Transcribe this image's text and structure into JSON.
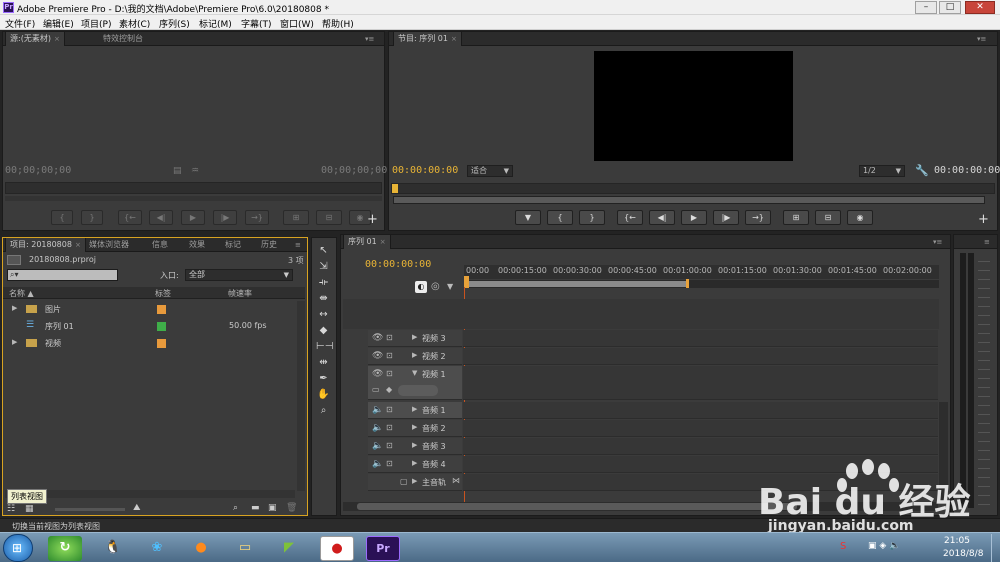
{
  "window": {
    "title": "Adobe Premiere Pro - D:\\我的文档\\Adobe\\Premiere Pro\\6.0\\20180808 *",
    "app_icon_text": "Pr"
  },
  "menu": [
    "文件(F)",
    "编辑(E)",
    "项目(P)",
    "素材(C)",
    "序列(S)",
    "标记(M)",
    "字幕(T)",
    "窗口(W)",
    "帮助(H)"
  ],
  "source_panel": {
    "tabs": [
      "源:(无素材)",
      "特效控制台"
    ],
    "timecode_left": "00;00;00;00",
    "timecode_right": "00;00;00;00"
  },
  "program_panel": {
    "tab": "节目: 序列 01",
    "timecode_left": "00:00:00:00",
    "fit_label": "适合",
    "resolution": "1/2",
    "timecode_right": "00:00:00:00"
  },
  "project_panel": {
    "tabs": [
      "项目: 20180808",
      "媒体浏览器",
      "信息",
      "效果",
      "标记",
      "历史"
    ],
    "file_name": "20180808.prproj",
    "item_count": "3 项",
    "in_label": "入口:",
    "in_value": "全部",
    "columns": [
      "名称",
      "标签",
      "帧速率"
    ],
    "items": [
      {
        "name": "图片",
        "label_color": "#e89a3c",
        "fps": ""
      },
      {
        "name": "序列 01",
        "label_color": "#3fae49",
        "fps": "50.00 fps"
      },
      {
        "name": "视频",
        "label_color": "#e89a3c",
        "fps": ""
      }
    ],
    "tooltip": "列表视图"
  },
  "timeline": {
    "tab": "序列 01",
    "timecode": "00:00:00:00",
    "ruler": [
      "00:00",
      "00:00:15:00",
      "00:00:30:00",
      "00:00:45:00",
      "00:01:00:00",
      "00:01:15:00",
      "00:01:30:00",
      "00:01:45:00",
      "00:02:00:00"
    ],
    "video_tracks": [
      "视频 3",
      "视频 2",
      "视频 1"
    ],
    "audio_tracks": [
      "音频 1",
      "音频 2",
      "音频 3",
      "音频 4"
    ],
    "master_track": "主音轨"
  },
  "status_bar": "切换当前视图为列表视图",
  "watermark": {
    "brand": "Bai du 经验",
    "url": "jingyan.baidu.com"
  },
  "taskbar": {
    "clock_time": "21:05",
    "clock_date": "2018/8/8"
  }
}
